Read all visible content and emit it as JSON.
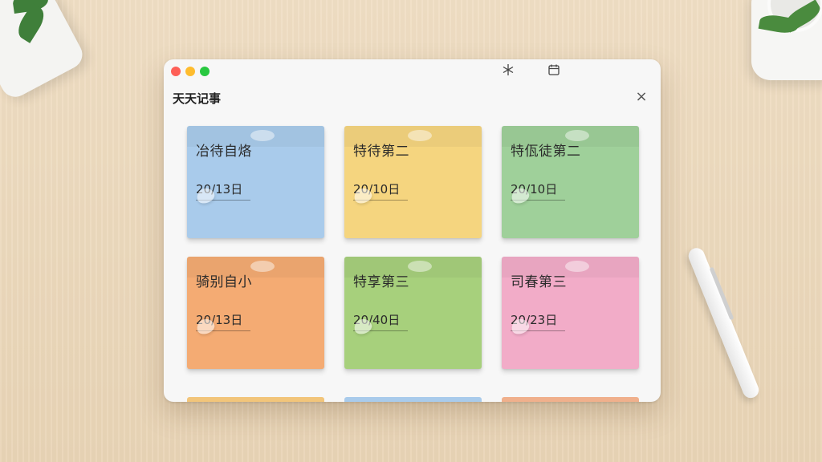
{
  "window": {
    "app_title": "天天记事",
    "toolbar_icons": [
      "snowflake-icon",
      "calendar-icon"
    ],
    "close_label": "×"
  },
  "notes": [
    {
      "title": "冶待自烙",
      "date": "20/13日",
      "color": "#a9cbeb"
    },
    {
      "title": "特待第二",
      "date": "20/10日",
      "color": "#f5d57f"
    },
    {
      "title": "特佤徒第二",
      "date": "20/10日",
      "color": "#9fd09a"
    },
    {
      "title": "骑别自小",
      "date": "20/13日",
      "color": "#f4ab73"
    },
    {
      "title": "特享第三",
      "date": "20/40日",
      "color": "#a7d07c"
    },
    {
      "title": "司春第三",
      "date": "20/23日",
      "color": "#f2acc8"
    }
  ],
  "peek_colors": [
    "#f2c57a",
    "#a9cbeb",
    "#f0b08c"
  ]
}
